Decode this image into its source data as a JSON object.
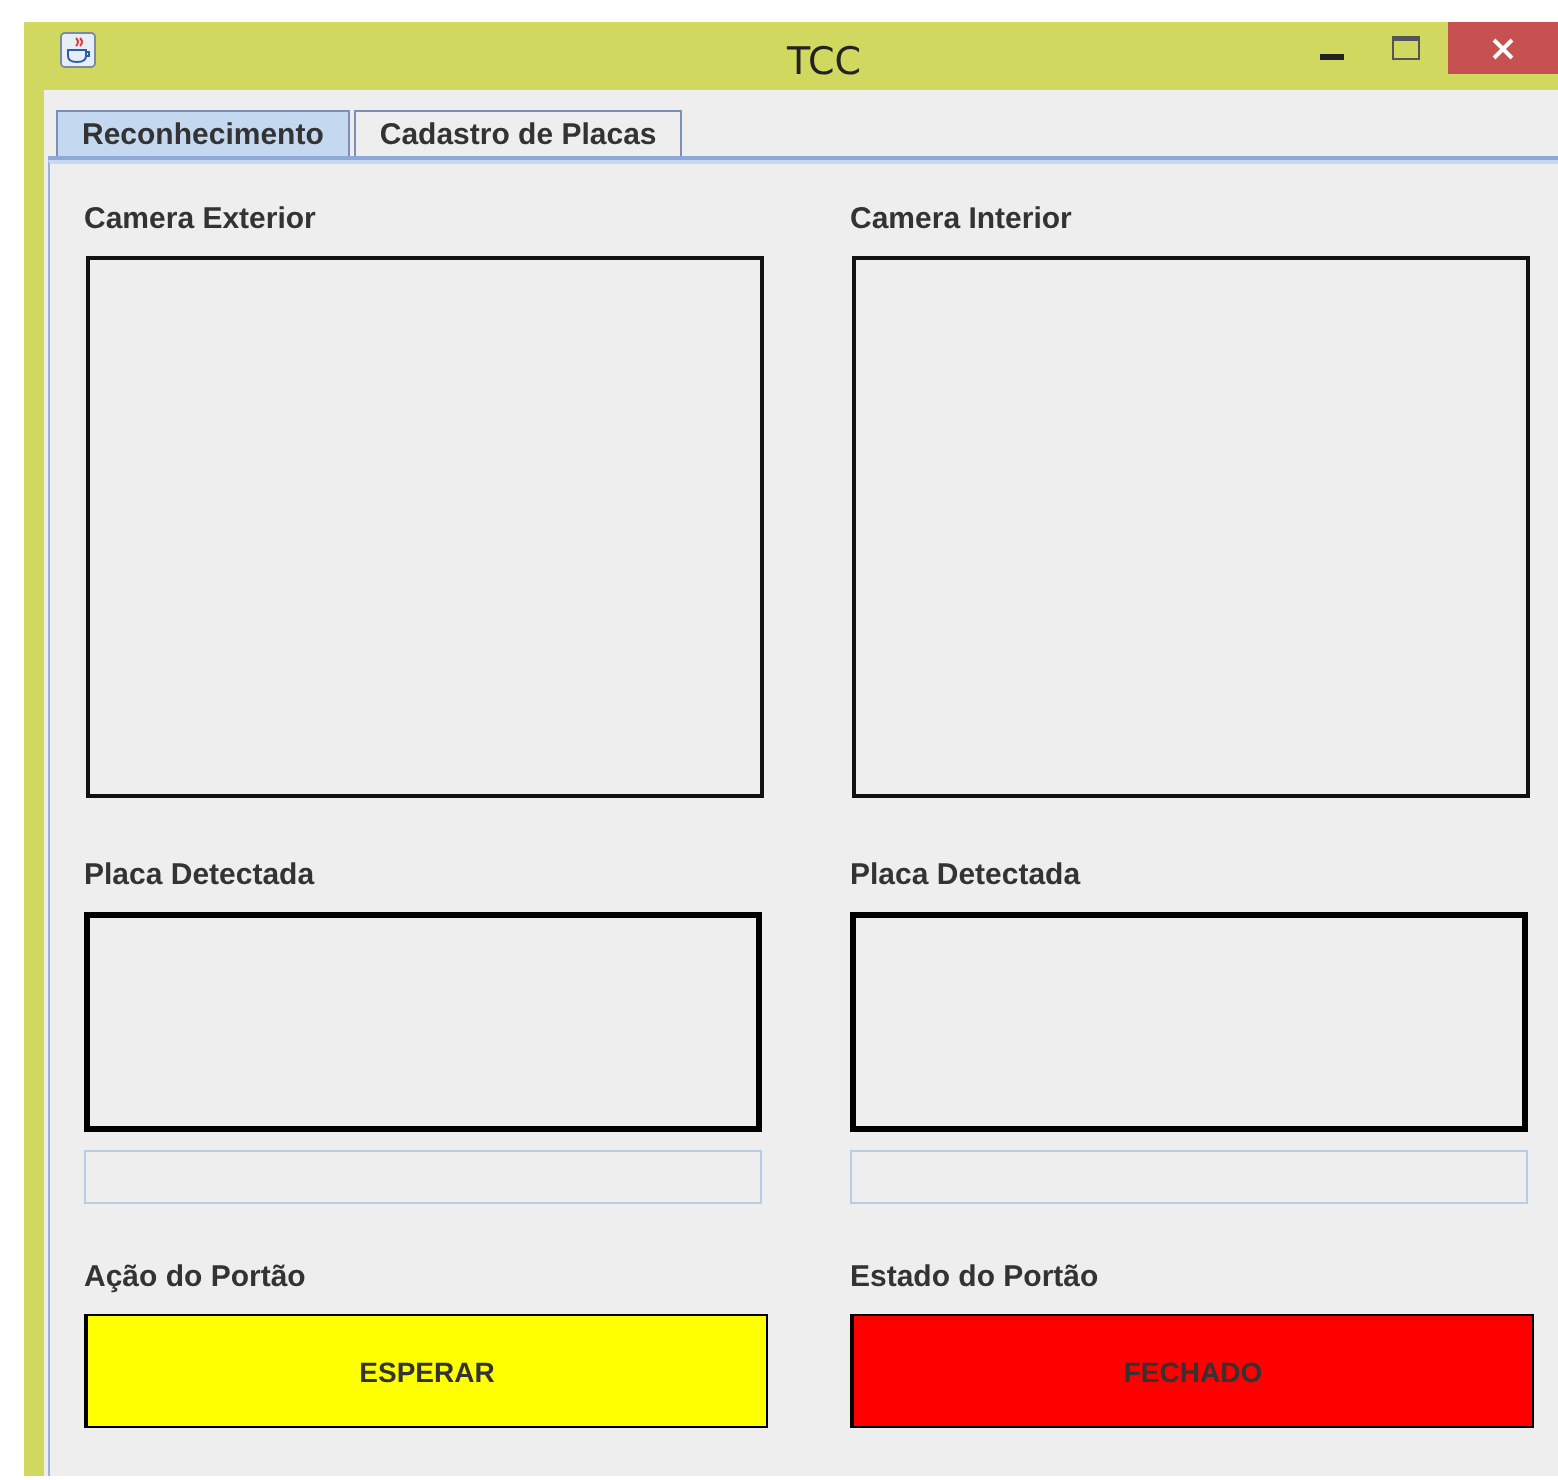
{
  "window": {
    "title": "TCC"
  },
  "tabs": [
    {
      "label": "Reconhecimento",
      "selected": true
    },
    {
      "label": "Cadastro de Placas",
      "selected": false
    }
  ],
  "columns": [
    {
      "camera": {
        "label": "Camera Exterior"
      },
      "plate": {
        "label": "Placa Detectada"
      },
      "gate": {
        "label": "Ação do Portão",
        "text": "ESPERAR",
        "color": "#ffff00"
      }
    },
    {
      "camera": {
        "label": "Camera Interior"
      },
      "plate": {
        "label": "Placa Detectada"
      },
      "gate": {
        "label": "Estado do Portão",
        "text": "FECHADO",
        "color": "#ff0000"
      }
    }
  ]
}
